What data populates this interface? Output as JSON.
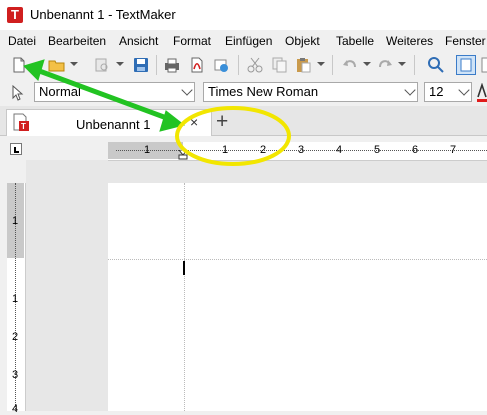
{
  "window": {
    "title": "Unbenannt 1 - TextMaker",
    "app_icon_letter": "T"
  },
  "menu": [
    "Datei",
    "Bearbeiten",
    "Ansicht",
    "Format",
    "Einfügen",
    "Objekt",
    "Tabelle",
    "Weiteres",
    "Fenster"
  ],
  "toolbar": {
    "icons": [
      "new-document-icon",
      "open-folder-icon",
      "print-preview-icon",
      "save-icon",
      "print-icon",
      "pdf-export-icon",
      "send-icon",
      "cut-icon",
      "copy-icon",
      "paste-icon",
      "undo-icon",
      "redo-icon",
      "search-icon",
      "page-layout-icon"
    ]
  },
  "formatbar": {
    "style_value": "Normal",
    "font_value": "Times New Roman",
    "size_value": "12"
  },
  "tabs": [
    {
      "label": "Unbenannt 1",
      "close": "×"
    }
  ],
  "new_tab_label": "+",
  "rulers": {
    "horizontal_labels": [
      "1",
      "1",
      "2",
      "3",
      "4",
      "5",
      "6",
      "7"
    ],
    "vertical_labels": [
      "1",
      "1",
      "2",
      "3",
      "4"
    ]
  },
  "annotations": {
    "arrow_color": "#22c322",
    "highlight_color": "#f2e600"
  }
}
